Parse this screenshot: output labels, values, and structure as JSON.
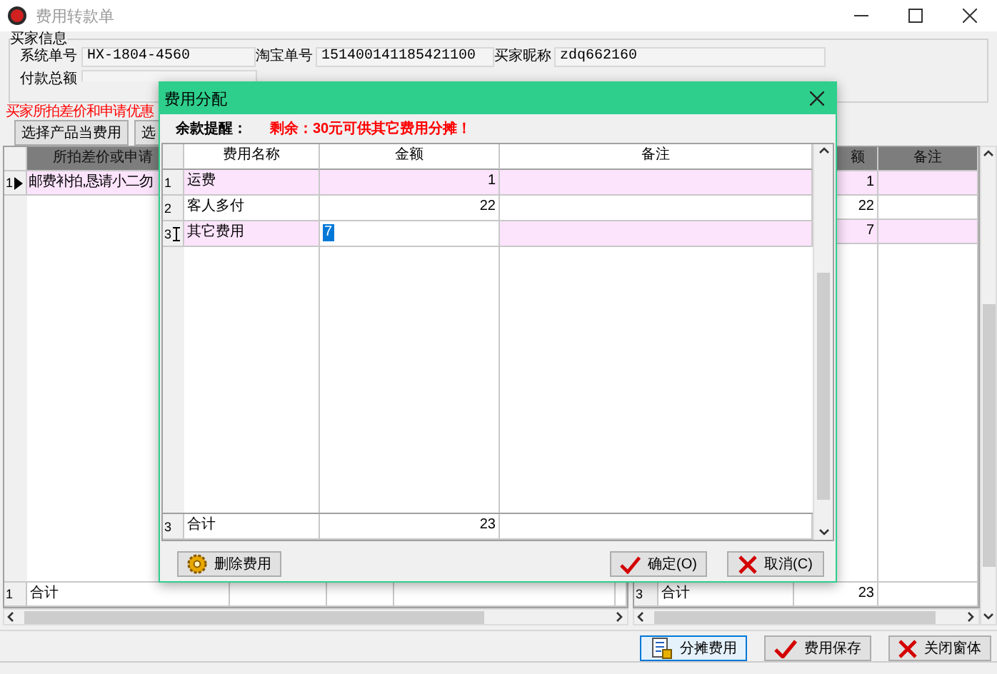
{
  "window": {
    "title": "费用转款单"
  },
  "buyer_info": {
    "title": "买家信息",
    "fields": [
      {
        "label": "系统单号",
        "value": "HX-1804-4560"
      },
      {
        "label": "淘宝单号",
        "value": "151400141185421100"
      },
      {
        "label": "买家昵称",
        "value": "zdq662160"
      },
      {
        "label": "付款总额"
      }
    ]
  },
  "differences": {
    "title": "买家所拍差价和申请优惠",
    "buttons": [
      "选择产品当费用",
      "选"
    ],
    "table": {
      "columns": [
        "所拍差价或申请"
      ],
      "rows": [
        {
          "index": "1",
          "item": "邮费补拍,恳请小二勿",
          "selected": true
        }
      ],
      "total": {
        "index": "1",
        "label": "合计"
      }
    }
  },
  "allocation_table": {
    "columns": [
      "额",
      "备注"
    ],
    "rows": [
      {
        "amount": "1"
      },
      {
        "amount": "22"
      },
      {
        "amount": "7"
      }
    ],
    "total": {
      "index": "3",
      "label": "合计",
      "amount": "23"
    }
  },
  "actions": [
    {
      "label": "分摊费用",
      "kind": "split"
    },
    {
      "label": "费用保存",
      "kind": "check"
    },
    {
      "label": "关闭窗体",
      "kind": "cross"
    }
  ],
  "dialog": {
    "title": "费用分配",
    "reminder_label": "余款提醒：",
    "reminder": "剩余：30元可供其它费用分摊！",
    "columns": [
      "费用名称",
      "金额",
      "备注"
    ],
    "rows": [
      {
        "index": "1",
        "name": "运费",
        "amount": "1",
        "selected": false
      },
      {
        "index": "2",
        "name": "客人多付",
        "amount": "22",
        "selected": false
      },
      {
        "index": "3",
        "name": "其它费用",
        "amount": "7",
        "selected": true
      }
    ],
    "total": {
      "index": "3",
      "label": "合计",
      "amount": "23"
    },
    "buttons": [
      {
        "label": "删除费用",
        "kind": "gear"
      },
      {
        "label": "确定(O)",
        "kind": "check"
      },
      {
        "label": "取消(C)",
        "kind": "cross"
      }
    ]
  }
}
